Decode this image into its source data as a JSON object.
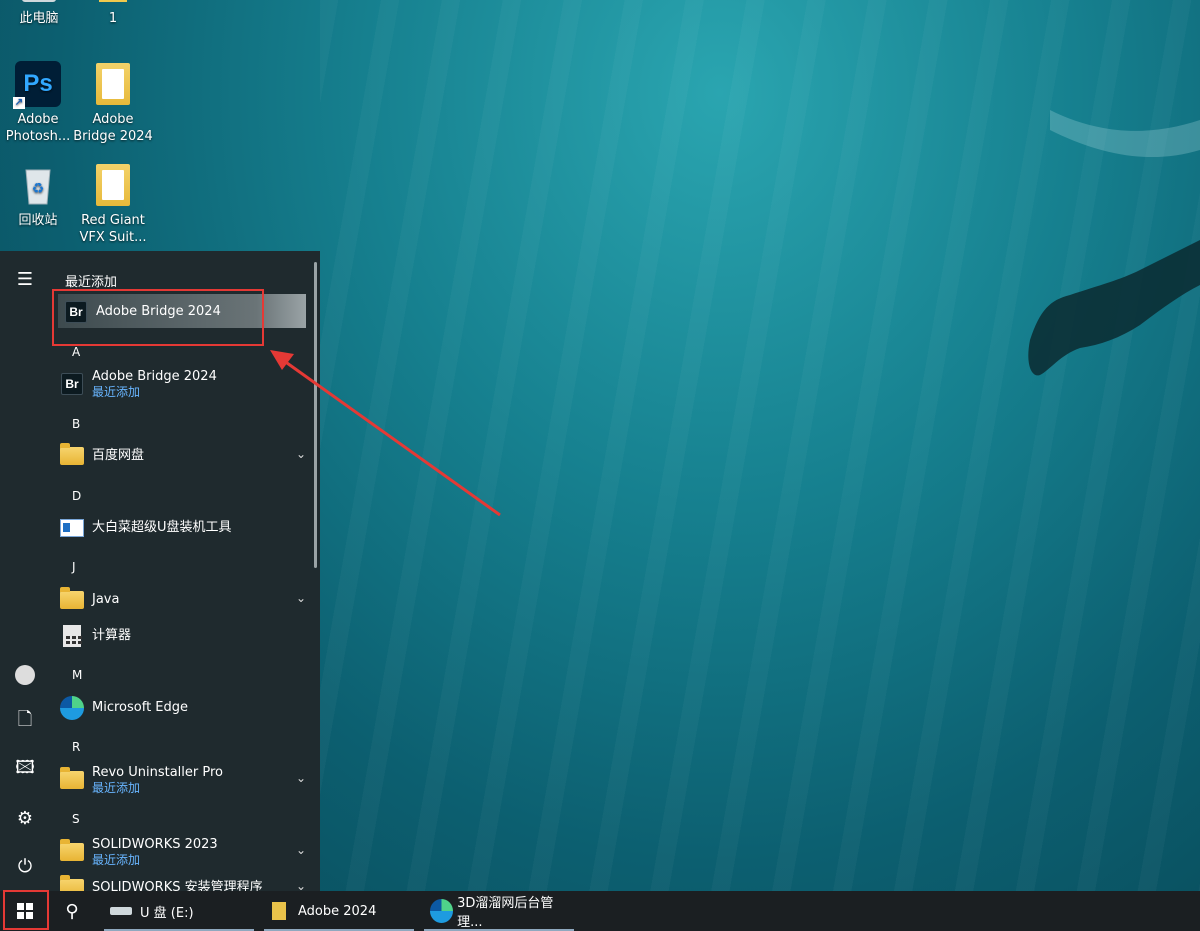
{
  "desktop": {
    "icons": [
      {
        "label": "此电脑",
        "name": "this-pc-icon"
      },
      {
        "label": "1",
        "name": "folder-1-icon"
      },
      {
        "label": "Adobe Photosh...",
        "name": "adobe-photoshop-icon"
      },
      {
        "label": "Adobe Bridge 2024",
        "name": "adobe-bridge-folder-icon"
      },
      {
        "label": "回收站",
        "name": "recycle-bin-icon"
      },
      {
        "label": "Red Giant VFX Suit...",
        "name": "red-giant-folder-icon"
      }
    ],
    "ps_glyph": "Ps"
  },
  "start_menu": {
    "recent_header": "最近添加",
    "recent_item": "Adobe Bridge 2024",
    "br_glyph": "Br",
    "groups": [
      {
        "letter": "A",
        "items": [
          {
            "label": "Adobe Bridge 2024",
            "sub": "最近添加",
            "icon": "adobe-bridge-icon"
          }
        ]
      },
      {
        "letter": "B",
        "items": [
          {
            "label": "百度网盘",
            "icon": "folder-icon"
          }
        ]
      },
      {
        "letter": "D",
        "items": [
          {
            "label": "大白菜超级U盘装机工具",
            "icon": "app-window-icon"
          }
        ]
      },
      {
        "letter": "J",
        "items": [
          {
            "label": "Java",
            "icon": "folder-icon"
          },
          {
            "label": "计算器",
            "icon": "calculator-icon"
          }
        ]
      },
      {
        "letter": "M",
        "items": [
          {
            "label": "Microsoft Edge",
            "icon": "edge-icon"
          }
        ]
      },
      {
        "letter": "R",
        "items": [
          {
            "label": "Revo Uninstaller Pro",
            "sub": "最近添加",
            "icon": "folder-icon"
          }
        ]
      },
      {
        "letter": "S",
        "items": [
          {
            "label": "SOLIDWORKS 2023",
            "sub": "最近添加",
            "icon": "folder-icon"
          },
          {
            "label": "SOLIDWORKS 安装管理程序",
            "icon": "folder-icon"
          }
        ]
      }
    ]
  },
  "taskbar": {
    "items": [
      {
        "label": "U 盘 (E:)",
        "icon": "usb-drive-icon"
      },
      {
        "label": "Adobe 2024",
        "icon": "folder-icon"
      },
      {
        "label": "3D溜溜网后台管理...",
        "icon": "edge-icon"
      }
    ]
  },
  "colors": {
    "accent_red": "#e53935",
    "link_blue": "#68b5ff",
    "menu_bg": "#1f2a2e",
    "taskbar_bg": "#1b1f22"
  }
}
